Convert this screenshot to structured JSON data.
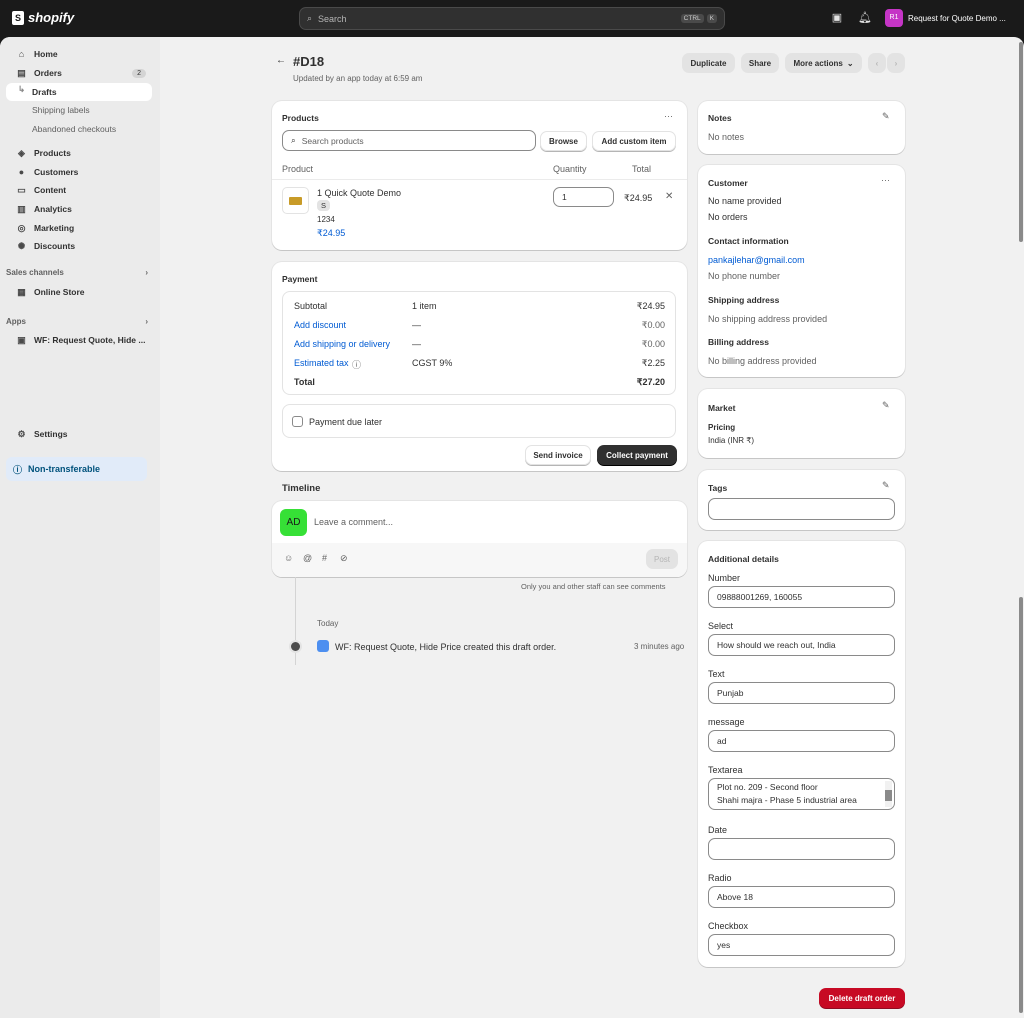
{
  "topbar": {
    "logo": "shopify",
    "search_placeholder": "Search",
    "kbd1": "CTRL",
    "kbd2": "K",
    "store_initials": "R1",
    "store_name": "Request for Quote Demo ..."
  },
  "sidebar": {
    "home": "Home",
    "orders": "Orders",
    "orders_count": "2",
    "drafts": "Drafts",
    "shipping_labels": "Shipping labels",
    "abandoned": "Abandoned checkouts",
    "products": "Products",
    "customers": "Customers",
    "content": "Content",
    "analytics": "Analytics",
    "marketing": "Marketing",
    "discounts": "Discounts",
    "sales_channels": "Sales channels",
    "online_store": "Online Store",
    "apps": "Apps",
    "app_item": "WF: Request Quote, Hide ...",
    "settings": "Settings",
    "non_transferable": "Non-transferable"
  },
  "header": {
    "title": "#D18",
    "subtitle": "Updated by an app today at 6:59 am",
    "duplicate": "Duplicate",
    "share": "Share",
    "more_actions": "More actions"
  },
  "products": {
    "title": "Products",
    "search_placeholder": "Search products",
    "browse": "Browse",
    "add_custom": "Add custom item",
    "col_product": "Product",
    "col_quantity": "Quantity",
    "col_total": "Total",
    "item_name": "1 Quick Quote Demo",
    "item_variant": "S",
    "item_sku": "1234",
    "item_price": "₹24.95",
    "item_qty": "1",
    "item_total": "₹24.95"
  },
  "payment": {
    "title": "Payment",
    "rows": [
      {
        "label": "Subtotal",
        "mid": "1 item",
        "value": "₹24.95"
      },
      {
        "label": "Add discount",
        "mid": "—",
        "value": "₹0.00"
      },
      {
        "label": "Add shipping or delivery",
        "mid": "—",
        "value": "₹0.00"
      },
      {
        "label": "Estimated tax",
        "mid": "CGST 9%",
        "value": "₹2.25"
      },
      {
        "label": "Total",
        "mid": "",
        "value": "₹27.20"
      }
    ],
    "due_later": "Payment due later",
    "send_invoice": "Send invoice",
    "collect_payment": "Collect payment"
  },
  "timeline": {
    "title": "Timeline",
    "avatar": "AD",
    "comment_placeholder": "Leave a comment...",
    "post": "Post",
    "staff_note": "Only you and other staff can see comments",
    "day": "Today",
    "event": "WF: Request Quote, Hide Price created this draft order.",
    "event_time": "3 minutes ago"
  },
  "notes": {
    "title": "Notes",
    "value": "No notes"
  },
  "customer": {
    "title": "Customer",
    "no_name": "No name provided",
    "no_orders": "No orders",
    "contact_title": "Contact information",
    "email": "pankajlehar@gmail.com",
    "phone": "No phone number",
    "shipping_title": "Shipping address",
    "shipping_value": "No shipping address provided",
    "billing_title": "Billing address",
    "billing_value": "No billing address provided"
  },
  "market": {
    "title": "Market",
    "pricing": "Pricing",
    "value": "India (INR ₹)"
  },
  "tags": {
    "title": "Tags",
    "value": ""
  },
  "additional": {
    "title": "Additional details",
    "fields": [
      {
        "label": "Number",
        "value": "09888001269, 160055"
      },
      {
        "label": "Select",
        "value": "How should we reach out, India"
      },
      {
        "label": "Text",
        "value": "Punjab"
      },
      {
        "label": "message",
        "value": "ad"
      },
      {
        "label": "Textarea",
        "value": "Plot no. 209 - Second floor",
        "value2": "Shahi majra - Phase 5 industrial area"
      },
      {
        "label": "Date",
        "value": ""
      },
      {
        "label": "Radio",
        "value": "Above 18"
      },
      {
        "label": "Checkbox",
        "value": "yes"
      }
    ]
  },
  "delete_button": "Delete draft order"
}
